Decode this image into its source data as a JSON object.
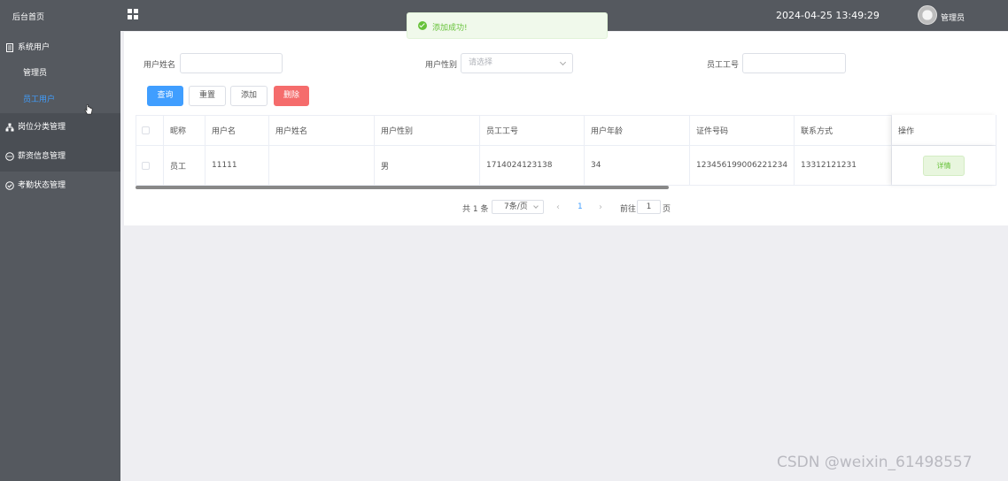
{
  "sidebar": {
    "home": "后台首页",
    "groups": [
      {
        "label": "系统用户",
        "icon": "document-icon"
      },
      {
        "label": "岗位分类管理",
        "icon": "org-chart-icon"
      },
      {
        "label": "薪资信息管理",
        "icon": "chat-icon"
      },
      {
        "label": "考勤状态管理",
        "icon": "check-circle-icon"
      }
    ],
    "subitems": [
      {
        "label": "管理员",
        "active": false
      },
      {
        "label": "员工用户",
        "active": true
      }
    ]
  },
  "topbar": {
    "title": "",
    "datetime": "2024-04-25 13:49:29",
    "role": "管理员"
  },
  "toast": {
    "message": "添加成功!",
    "type": "success"
  },
  "search": {
    "name_label": "用户姓名",
    "name_value": "",
    "gender_label": "用户性别",
    "gender_placeholder": "请选择",
    "empno_label": "员工工号",
    "empno_value": ""
  },
  "buttons": {
    "query": "查询",
    "reset": "重置",
    "add": "添加",
    "delete": "删除"
  },
  "table": {
    "headers": [
      "昵称",
      "用户名",
      "用户姓名",
      "用户性别",
      "员工工号",
      "用户年龄",
      "证件号码",
      "联系方式",
      "操作"
    ],
    "rows": [
      {
        "nickname": "员工",
        "username": "11111",
        "fullname": "",
        "gender": "男",
        "empno": "1714024123138",
        "age": "34",
        "idno": "123456199006221234",
        "phone": "13312121231",
        "action": "详情"
      }
    ]
  },
  "pagination": {
    "total": "共 1 条",
    "page_size": "7条/页",
    "current": "1",
    "goto_label": "前往",
    "goto_value": "1",
    "page_unit": "页"
  },
  "watermark": "CSDN @weixin_61498557",
  "colors": {
    "primary": "#409eff",
    "danger": "#f56c6c",
    "success": "#67c23a",
    "sidebar": "#55595f"
  }
}
